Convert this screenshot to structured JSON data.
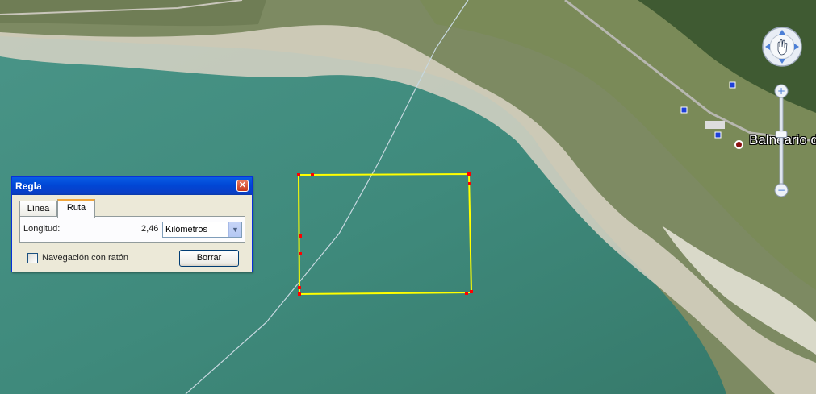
{
  "window": {
    "title": "Regla"
  },
  "ruler": {
    "tabs": [
      {
        "label": "Línea",
        "active": false
      },
      {
        "label": "Ruta",
        "active": true
      }
    ],
    "length_label": "Longitud:",
    "length_value": "2,46",
    "unit_selected": "Kilómetros",
    "mouse_nav_label": "Navegación con ratón",
    "mouse_nav_checked": false,
    "clear_label": "Borrar"
  },
  "map": {
    "place_label": "Balneario d",
    "path_color": "#ffff00",
    "vertex_color": "#ff0000"
  },
  "nav_controls": {
    "zoom_in": "+",
    "zoom_out": "−",
    "zoom_level": 0.42
  },
  "icons": {
    "close": "close-icon",
    "dropdown": "chevron-down-icon",
    "pan": "hand-pan-icon",
    "place": "place-marker-icon"
  }
}
